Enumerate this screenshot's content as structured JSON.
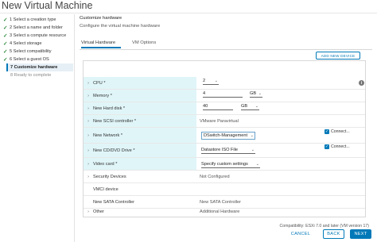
{
  "window": {
    "title": "New Virtual Machine"
  },
  "steps": [
    {
      "label": "1 Select a creation type",
      "state": "done"
    },
    {
      "label": "2 Select a name and folder",
      "state": "done"
    },
    {
      "label": "3 Select a compute resource",
      "state": "done"
    },
    {
      "label": "4 Select storage",
      "state": "done"
    },
    {
      "label": "5 Select compatibility",
      "state": "done"
    },
    {
      "label": "6 Select a guest OS",
      "state": "done"
    },
    {
      "label": "7 Customize hardware",
      "state": "active"
    },
    {
      "label": "8 Ready to complete",
      "state": "pending"
    }
  ],
  "header": {
    "title": "Customize hardware",
    "subtitle": "Configure the virtual machine hardware"
  },
  "tabs": [
    {
      "label": "Virtual Hardware"
    },
    {
      "label": "VM Options"
    }
  ],
  "add_device_label": "ADD NEW DEVICE",
  "hardware": {
    "cpu": {
      "label": "CPU *",
      "value": "2"
    },
    "memory": {
      "label": "Memory *",
      "value": "4",
      "unit": "GB"
    },
    "hard_disk": {
      "label": "New Hard disk *",
      "value": "40",
      "unit": "GB"
    },
    "scsi": {
      "label": "New SCSI controller *",
      "value": "VMware Paravirtual"
    },
    "network": {
      "label": "New Network *",
      "value": "DSwitch-Management",
      "connect_label": "Connect..."
    },
    "cdrom": {
      "label": "New CD/DVD Drive *",
      "value": "Datastore ISO File",
      "connect_label": "Connect..."
    },
    "video": {
      "label": "Video card *",
      "value": "Specify custom settings"
    },
    "security": {
      "label": "Security Devices",
      "value": "Not Configured"
    },
    "vmci": {
      "label": "VMCI device",
      "value": ""
    },
    "sata": {
      "label": "New SATA Controller",
      "value": "New SATA Controller"
    },
    "other": {
      "label": "Other",
      "value": "Additional Hardware"
    }
  },
  "compatibility": "Compatibility: ESXi 7.0 and later (VM version 17)",
  "footer": {
    "cancel": "CANCEL",
    "back": "BACK",
    "next": "NEXT"
  },
  "icons": {
    "check": "check-icon",
    "caret": "chevron-right-icon",
    "dropdown": "chevron-down-icon",
    "info": "info-icon"
  },
  "colors": {
    "accent": "#0079b8",
    "highlight": "#e0f5f8",
    "check": "#2e8b3d"
  }
}
